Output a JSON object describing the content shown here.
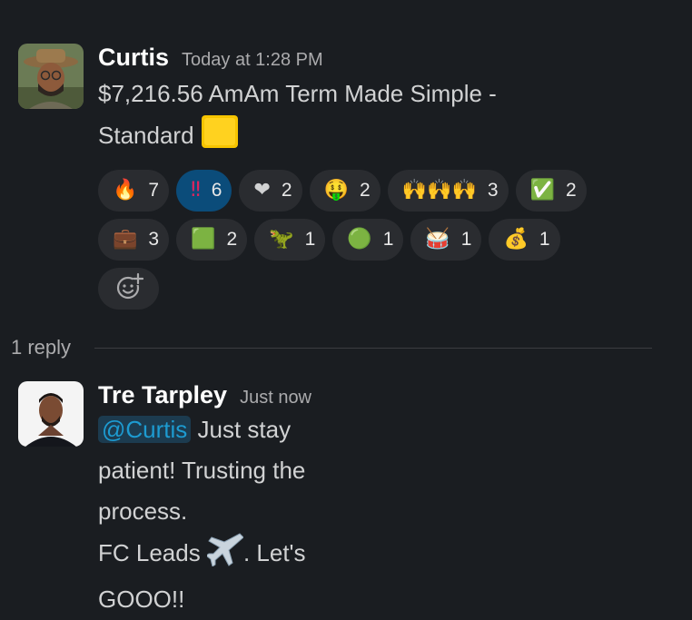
{
  "messages": [
    {
      "author": "Curtis",
      "timestamp": "Today at 1:28 PM",
      "text_line1": "$7,216.56 AmAm Term Made Simple -",
      "text_line2": "Standard",
      "text_emoji_icon": "yellow-square-icon",
      "reactions": [
        {
          "icon": "fire-icon",
          "emoji": "🔥",
          "count": "7",
          "active": false
        },
        {
          "icon": "double-exclamation-icon",
          "emoji": "‼",
          "count": "6",
          "active": true
        },
        {
          "icon": "red-heart-icon",
          "emoji": "❤",
          "count": "2",
          "active": false
        },
        {
          "icon": "money-mouth-face-icon",
          "emoji": "🤑",
          "count": "2",
          "active": false
        },
        {
          "icon": "raised-hands-icon",
          "emoji": "🙌🙌🙌",
          "count": "3",
          "active": false
        },
        {
          "icon": "check-mark-button-icon",
          "emoji": "✅",
          "count": "2",
          "active": false
        },
        {
          "icon": "briefcase-icon",
          "emoji": "💼",
          "count": "3",
          "active": false
        },
        {
          "icon": "green-square-icon",
          "emoji": "🟩",
          "count": "2",
          "active": false
        },
        {
          "icon": "t-rex-icon",
          "emoji": "🦖",
          "count": "1",
          "active": false
        },
        {
          "icon": "green-circle-icon",
          "emoji": "🟢",
          "count": "1",
          "active": false
        },
        {
          "icon": "drum-icon",
          "emoji": "🥁",
          "count": "1",
          "active": false
        },
        {
          "icon": "money-bag-icon",
          "emoji": "💰",
          "count": "1",
          "active": false
        }
      ],
      "add_reaction_icon": "add-reaction-icon"
    },
    {
      "author": "Tre Tarpley",
      "timestamp": "Just now",
      "mention": "@Curtis",
      "text_line1": " Just stay patient! Trusting the process.",
      "text_line2_start": "FC Leads ",
      "text_line2_end": ". Let's GOOO!!",
      "text_emoji_icon": "airplane-icon"
    }
  ],
  "thread": {
    "reply_count": "1 reply"
  },
  "colors": {
    "background": "#1a1d21",
    "chip": "#2a2c30",
    "chip_active": "#0b4c7a",
    "mention": "#1d9bd1",
    "mention_bg": "#1c3b4f"
  }
}
